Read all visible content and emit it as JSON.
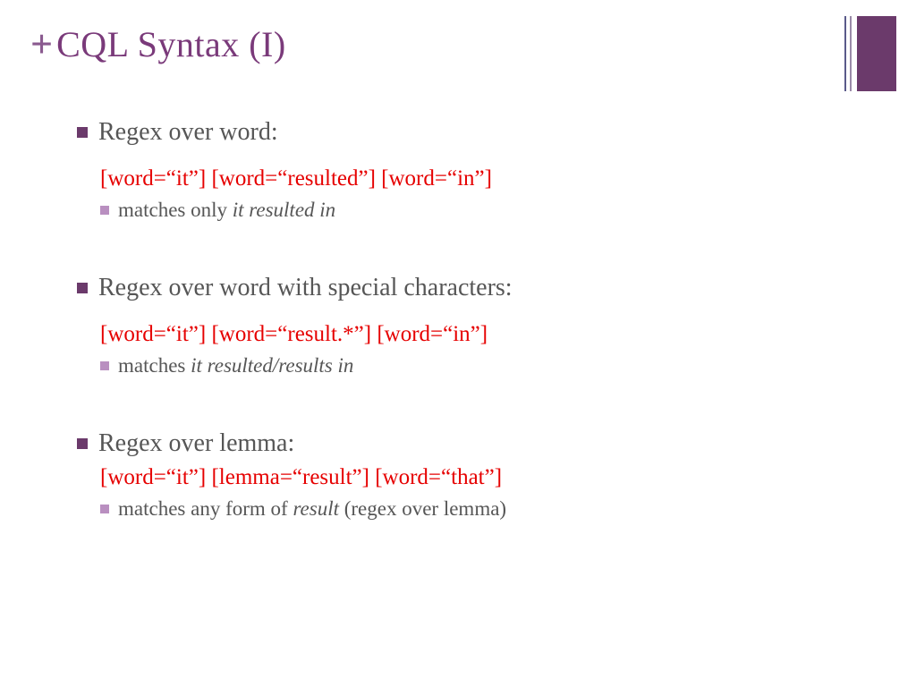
{
  "header": {
    "plus": "+",
    "title": "CQL Syntax (I)"
  },
  "sections": [
    {
      "heading": "Regex over word:",
      "code": "[word=“it”] [word=“resulted”] [word=“in”]",
      "match_prefix": "matches only ",
      "match_italic": "it resulted in",
      "match_suffix": ""
    },
    {
      "heading": "Regex over word with special characters:",
      "code": "[word=“it”] [word=“result.*”] [word=“in”]",
      "match_prefix": "matches ",
      "match_italic": "it resulted/results in",
      "match_suffix": ""
    },
    {
      "heading": "Regex over lemma:",
      "code": "[word=“it”] [lemma=“result”] [word=“that”]",
      "match_prefix": "matches any form of ",
      "match_italic": "result",
      "match_suffix": " (regex over lemma)"
    }
  ]
}
